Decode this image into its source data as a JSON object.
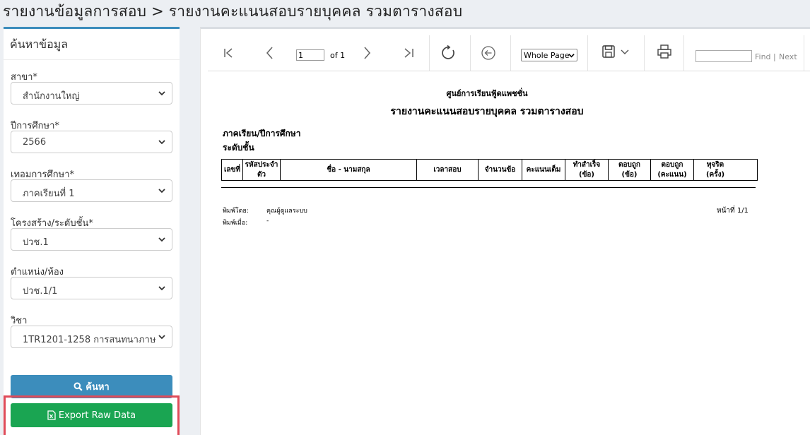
{
  "page": {
    "title": "รายงานข้อมูลการสอบ > รายงานคะแนนสอบรายบุคคล รวมตารางสอบ"
  },
  "sidebar": {
    "heading": "ค้นหาข้อมูล",
    "fields": [
      {
        "label": "สาขา*",
        "value": "สำนักงานใหญ่"
      },
      {
        "label": "ปีการศึกษา*",
        "value": "2566"
      },
      {
        "label": "เทอมการศึกษา*",
        "value": "ภาคเรียนที่ 1"
      },
      {
        "label": "โครงสร้าง/ระดับชั้น*",
        "value": "ปวช.1"
      },
      {
        "label": "ตำแหน่ง/ห้อง",
        "value": "ปวช.1/1"
      },
      {
        "label": "วิชา",
        "value": "1TR1201-1258 การสนทนาภาษ"
      }
    ],
    "search_button": "ค้นหา",
    "export_button": "Export Raw Data"
  },
  "viewer": {
    "page_number": "1",
    "page_of": "of 1",
    "zoom": "Whole Page",
    "find_label": "Find",
    "find_separator": "|",
    "next_label": "Next",
    "find_value": ""
  },
  "report": {
    "school_name": "ศูนย์การเรียนฟู้ดแพชชั่น",
    "title": "รายงานคะแนนสอบรายบุคคล รวมตารางสอบ",
    "semester_label": "ภาคเรียน/ปีการศึกษา",
    "level_label": "ระดับชั้น",
    "columns": [
      "เลขที่",
      "รหัสประจำตัว",
      "ชื่อ - นามสกุล",
      "เวลาสอบ",
      "จำนวนข้อ",
      "คะแนนเต็ม",
      "ทำสำเร็จ\n(ข้อ)",
      "ตอบถูก\n(ข้อ)",
      "ตอบถูก\n(คะแนน)",
      "ทุจริต\n(ครั้ง)"
    ],
    "printed_by_label": "พิมพ์โดย:",
    "printed_by_value": "คุณผู้ดูแลระบบ",
    "printed_at_label": "พิมพ์เมื่อ:",
    "printed_at_value": "-",
    "page_info": "หน้าที่ 1/1"
  }
}
